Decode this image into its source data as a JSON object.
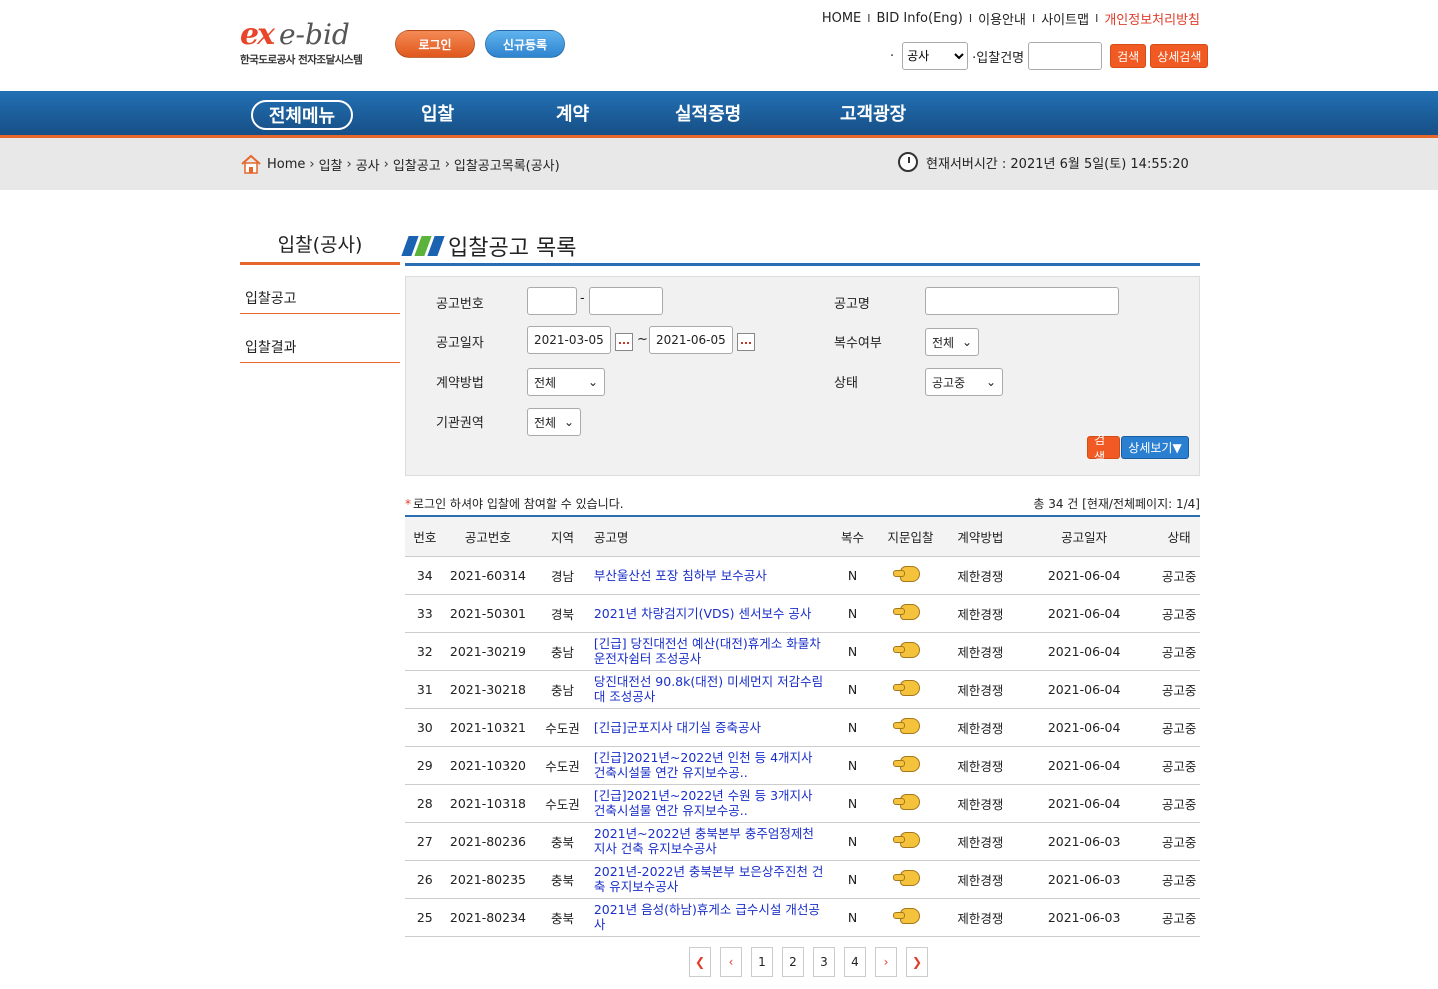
{
  "header": {
    "logo_mark": "ex",
    "logo_text": "e-bid",
    "logo_sub": "한국도로공사 전자조달시스템",
    "login_label": "로그인",
    "join_label": "신규등록",
    "topnav": [
      "HOME",
      "BID Info(Eng)",
      "이용안내",
      "사이트맵",
      "개인정보처리방침"
    ],
    "top_search": {
      "dot": "·",
      "type_value": "공사",
      "label": "·입찰건명",
      "search_label": "검색",
      "detail_label": "상세검색"
    }
  },
  "mainnav": {
    "all_menu": "전체메뉴",
    "items": [
      "입찰",
      "계약",
      "실적증명",
      "고객광장"
    ]
  },
  "breadcrumb": {
    "items": [
      "Home",
      "입찰",
      "공사",
      "입찰공고",
      "입찰공고목록(공사)"
    ],
    "server_time_label": "현재서버시간 : 2021년 6월 5일(토) 14:55:20"
  },
  "sidebar": {
    "title": "입찰(공사)",
    "items": [
      "입찰공고",
      "입찰결과"
    ]
  },
  "content": {
    "title": "입찰공고 목록"
  },
  "search_panel": {
    "notice_no_label": "공고번호",
    "notice_no_dash": "-",
    "notice_name_label": "공고명",
    "date_label": "공고일자",
    "date_from": "2021-03-05",
    "date_to": "2021-06-05",
    "date_sep": "~",
    "multi_label": "복수여부",
    "multi_value": "전체",
    "method_label": "계약방법",
    "method_value": "전체",
    "status_label": "상태",
    "status_value": "공고중",
    "region_label": "기관권역",
    "region_value": "전체",
    "search_label": "검색",
    "detail_label": "상세보기▼"
  },
  "list_info": {
    "notice": "로그인 하셔야 입찰에 참여할 수 있습니다.",
    "notice_star": "*",
    "total": "총 34 건 [현재/전체페이지: 1/4]"
  },
  "table": {
    "headers": [
      "번호",
      "공고번호",
      "지역",
      "공고명",
      "복수",
      "지문입찰",
      "계약방법",
      "공고일자",
      "상태"
    ],
    "rows": [
      [
        "34",
        "2021-60314",
        "경남",
        "부산울산선 포장 침하부 보수공사",
        "N",
        "제한경쟁",
        "2021-06-04",
        "공고중"
      ],
      [
        "33",
        "2021-50301",
        "경북",
        "2021년 차량검지기(VDS) 센서보수 공사",
        "N",
        "제한경쟁",
        "2021-06-04",
        "공고중"
      ],
      [
        "32",
        "2021-30219",
        "충남",
        "[긴급] 당진대전선 예산(대전)휴게소 화물차 운전자쉼터 조성공사",
        "N",
        "제한경쟁",
        "2021-06-04",
        "공고중"
      ],
      [
        "31",
        "2021-30218",
        "충남",
        "당진대전선 90.8k(대전) 미세먼지 저감수림대 조성공사",
        "N",
        "제한경쟁",
        "2021-06-04",
        "공고중"
      ],
      [
        "30",
        "2021-10321",
        "수도권",
        "[긴급]군포지사 대기실 증축공사",
        "N",
        "제한경쟁",
        "2021-06-04",
        "공고중"
      ],
      [
        "29",
        "2021-10320",
        "수도권",
        "[긴급]2021년~2022년 인천 등 4개지사 건축시설물 연간 유지보수공..",
        "N",
        "제한경쟁",
        "2021-06-04",
        "공고중"
      ],
      [
        "28",
        "2021-10318",
        "수도권",
        "[긴급]2021년~2022년 수원 등 3개지사 건축시설물 연간 유지보수공..",
        "N",
        "제한경쟁",
        "2021-06-04",
        "공고중"
      ],
      [
        "27",
        "2021-80236",
        "충북",
        "2021년~2022년 충북본부 충주엄정제천지사 건축 유지보수공사",
        "N",
        "제한경쟁",
        "2021-06-03",
        "공고중"
      ],
      [
        "26",
        "2021-80235",
        "충북",
        "2021년-2022년 충북본부 보은상주진천 건축 유지보수공사",
        "N",
        "제한경쟁",
        "2021-06-03",
        "공고중"
      ],
      [
        "25",
        "2021-80234",
        "충북",
        "2021년 음성(하남)휴게소 급수시설 개선공사",
        "N",
        "제한경쟁",
        "2021-06-03",
        "공고중"
      ]
    ]
  },
  "pager": {
    "first": "❮",
    "prev": "‹",
    "pages": [
      "1",
      "2",
      "3",
      "4"
    ],
    "next": "›",
    "last": "❯"
  },
  "colors": {
    "brand_orange": "#e6662c",
    "nav_blue": "#1c5f9f",
    "link_blue": "#1a2fc9"
  }
}
